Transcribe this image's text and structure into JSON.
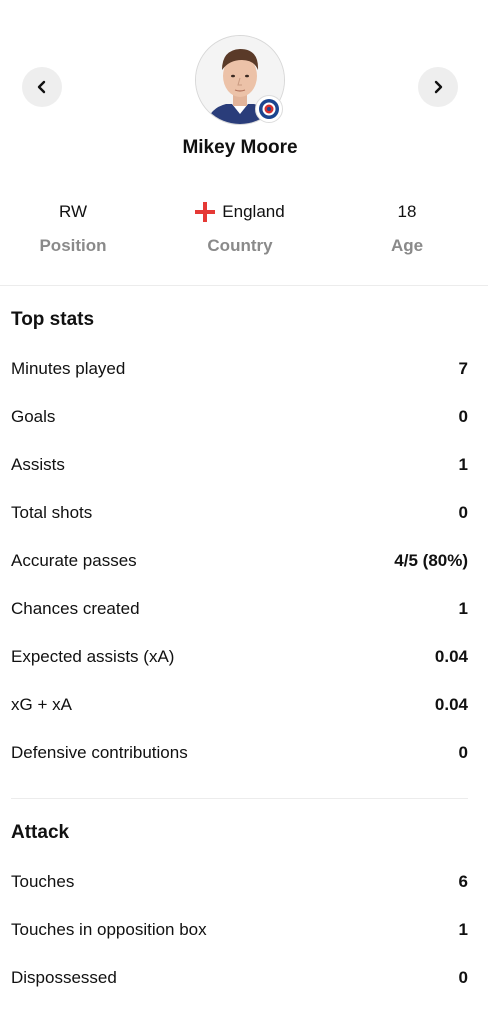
{
  "header": {
    "player_name": "Mikey Moore",
    "prev_icon": "chevron-left-icon",
    "next_icon": "chevron-right-icon",
    "club_badge_icon": "club-crest-icon"
  },
  "info": {
    "position": {
      "value": "RW",
      "label": "Position"
    },
    "country": {
      "value": "England",
      "label": "Country",
      "flag_icon": "england-flag-icon"
    },
    "age": {
      "value": "18",
      "label": "Age"
    }
  },
  "top_stats": {
    "title": "Top stats",
    "rows": [
      {
        "label": "Minutes played",
        "value": "7"
      },
      {
        "label": "Goals",
        "value": "0"
      },
      {
        "label": "Assists",
        "value": "1"
      },
      {
        "label": "Total shots",
        "value": "0"
      },
      {
        "label": "Accurate passes",
        "value": "4/5 (80%)"
      },
      {
        "label": "Chances created",
        "value": "1"
      },
      {
        "label": "Expected assists (xA)",
        "value": "0.04"
      },
      {
        "label": "xG + xA",
        "value": "0.04"
      },
      {
        "label": "Defensive contributions",
        "value": "0"
      }
    ]
  },
  "attack": {
    "title": "Attack",
    "rows": [
      {
        "label": "Touches",
        "value": "6"
      },
      {
        "label": "Touches in opposition box",
        "value": "1"
      },
      {
        "label": "Dispossessed",
        "value": "0"
      }
    ]
  },
  "colors": {
    "nav_button_bg": "#eeeeee",
    "muted_label": "#8a8a8a",
    "flag_red": "#e53935",
    "club_blue": "#1b458f"
  }
}
